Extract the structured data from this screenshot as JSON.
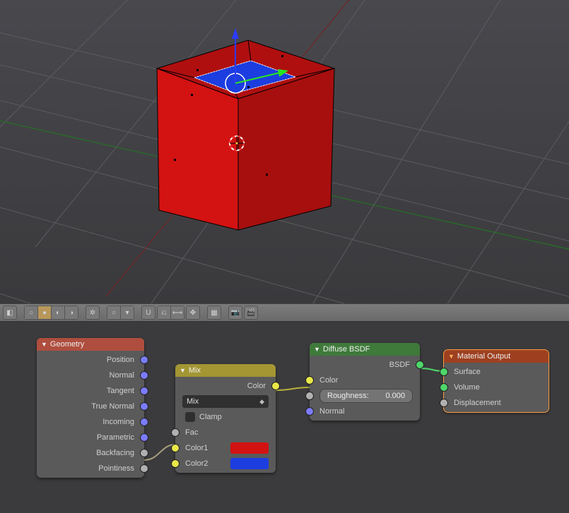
{
  "viewport": {
    "arrow_green": "#27e61f",
    "arrow_blue": "#2a3cff",
    "cube_fill": "#d31212",
    "face_fill": "#1c3de0",
    "pivot": "#ffffff",
    "cursor_red": "#ff3b3b"
  },
  "toolbar": {
    "shading_mode_active": "solid"
  },
  "nodes": {
    "geometry": {
      "title": "Geometry",
      "sockets": [
        "Position",
        "Normal",
        "Tangent",
        "True Normal",
        "Incoming",
        "Parametric",
        "Backfacing",
        "Pointiness"
      ]
    },
    "mix": {
      "title": "Mix",
      "out": "Color",
      "dropdown": "Mix",
      "clamp": "Clamp",
      "fac": "Fac",
      "color1": "Color1",
      "color2": "Color2",
      "swatch1": "#d31212",
      "swatch2": "#1c3de0"
    },
    "diffuse": {
      "title": "Diffuse BSDF",
      "out": "BSDF",
      "color": "Color",
      "roughness_label": "Roughness:",
      "roughness_value": "0.000",
      "normal": "Normal"
    },
    "output": {
      "title": "Material Output",
      "surface": "Surface",
      "volume": "Volume",
      "displacement": "Displacement"
    }
  }
}
